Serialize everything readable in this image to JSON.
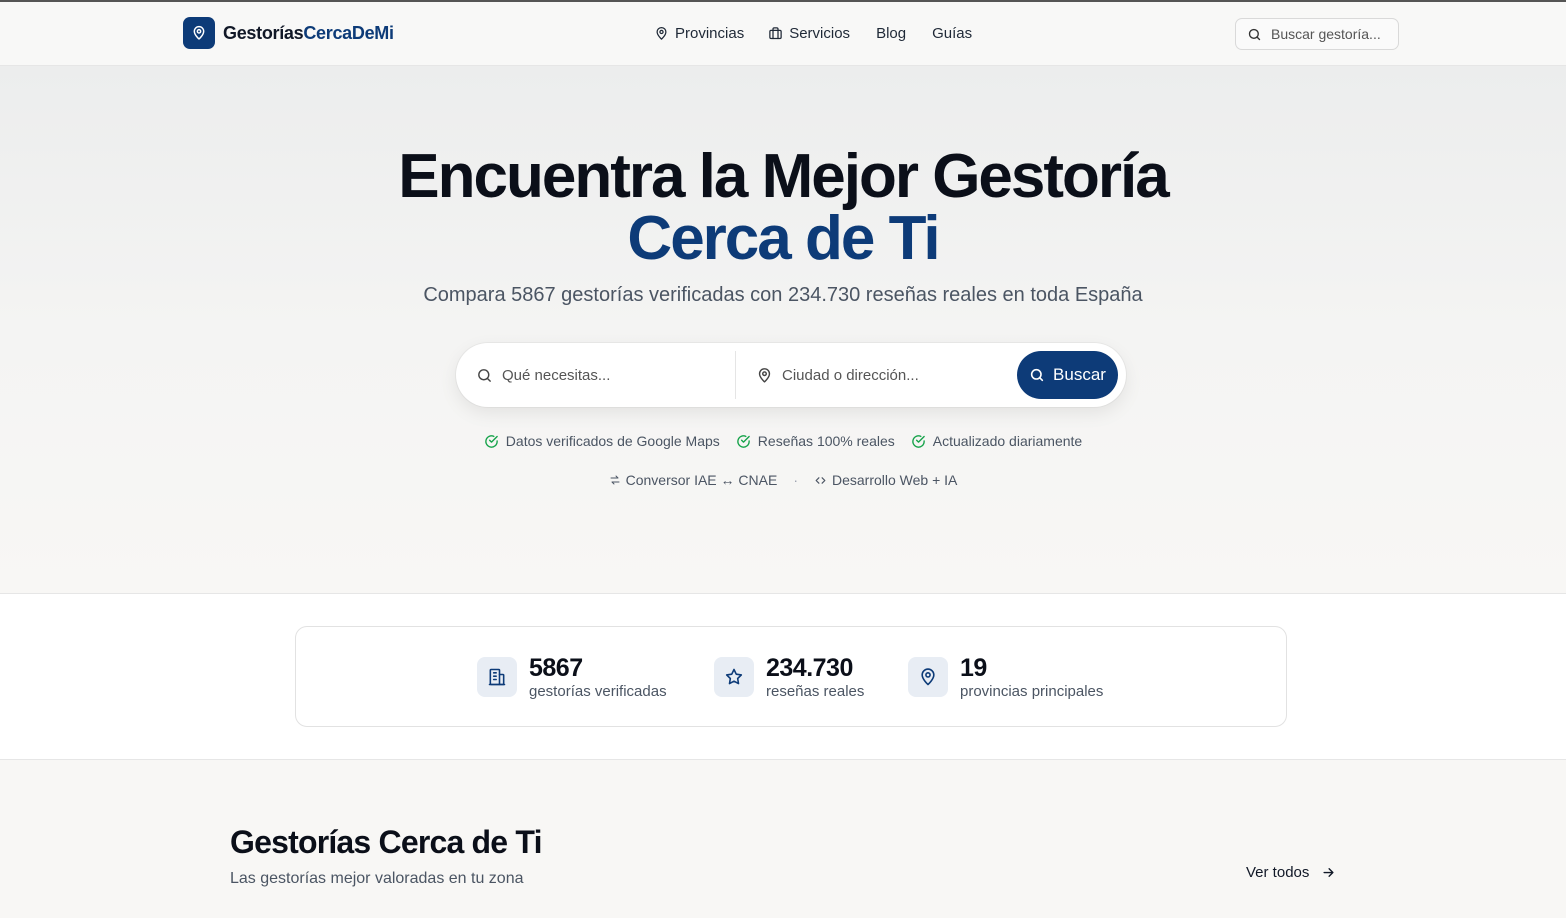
{
  "header": {
    "logo_part1": "Gestorías",
    "logo_part2": "CercaDeMi",
    "nav": [
      {
        "label": "Provincias",
        "icon": "map-pin-icon"
      },
      {
        "label": "Servicios",
        "icon": "briefcase-icon"
      },
      {
        "label": "Blog"
      },
      {
        "label": "Guías"
      }
    ],
    "search_placeholder": "Buscar gestoría..."
  },
  "hero": {
    "title_line1": "Encuentra la Mejor Gestoría",
    "title_line2": "Cerca de Ti",
    "subtitle": "Compara 5867 gestorías verificadas con 234.730 reseñas reales en toda España",
    "what_placeholder": "Qué necesitas...",
    "where_placeholder": "Ciudad o dirección...",
    "search_button": "Buscar",
    "badges": [
      "Datos verificados de Google Maps",
      "Reseñas 100% reales",
      "Actualizado diariamente"
    ],
    "tool_links": [
      "Conversor IAE ↔ CNAE",
      "Desarrollo Web + IA"
    ],
    "separator": "·"
  },
  "stats": [
    {
      "value": "5867",
      "label": "gestorías verificadas",
      "icon": "building-icon"
    },
    {
      "value": "234.730",
      "label": "reseñas reales",
      "icon": "star-icon"
    },
    {
      "value": "19",
      "label": "provincias principales",
      "icon": "map-pin-icon"
    }
  ],
  "section": {
    "title": "Gestorías Cerca de Ti",
    "subtitle": "Las gestorías mejor valoradas en tu zona",
    "see_all": "Ver todos"
  },
  "colors": {
    "brand": "#0d3b78",
    "check": "#16a34a"
  }
}
